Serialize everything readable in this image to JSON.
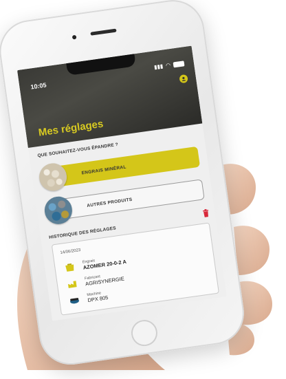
{
  "status_bar": {
    "time": "10:05"
  },
  "header": {
    "title": "Mes réglages"
  },
  "question": "QUE SOUHAITEZ-VOUS ÉPANDRE ?",
  "options": [
    {
      "label": "ENGRAIS MINÉRAL"
    },
    {
      "label": "AUTRES PRODUITS"
    }
  ],
  "history": {
    "title": "HISTORIQUE DES RÉGLAGES",
    "entry": {
      "date": "14/06/2023",
      "fertilizer": {
        "key": "Engrais",
        "value": "AZOMER 20-0-2 A"
      },
      "manufacturer": {
        "key": "Fabricant",
        "value": "AGRISYNERGIE"
      },
      "machine": {
        "key": "Machine",
        "value": "DPX 805"
      }
    }
  },
  "colors": {
    "accent": "#d4c619",
    "header_bg": "#3a3a36",
    "screen_bg": "#efefef"
  }
}
